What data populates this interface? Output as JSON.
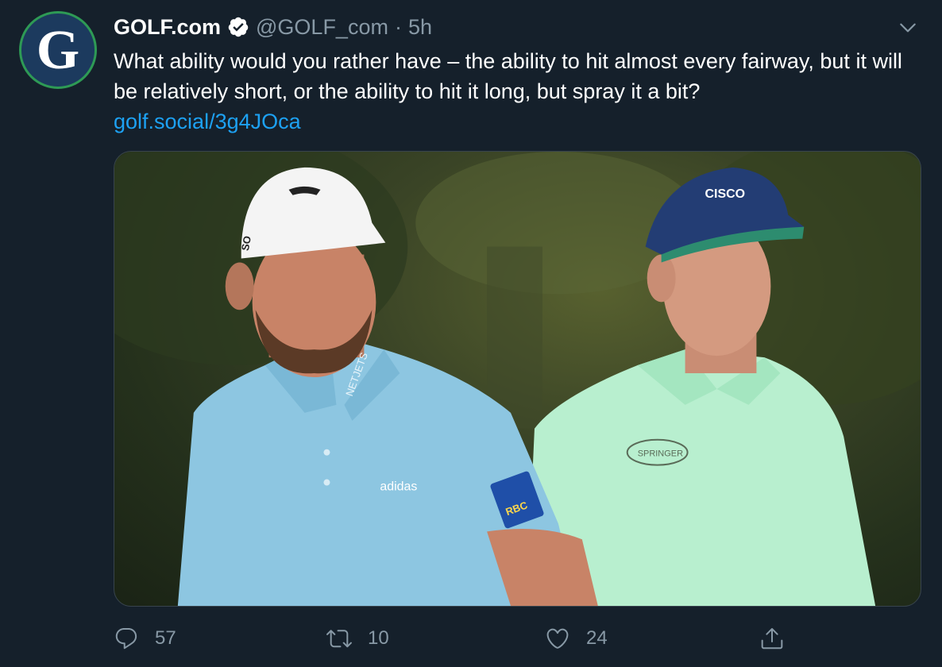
{
  "tweet": {
    "author": {
      "avatar_letter": "G",
      "display_name": "GOLF.com",
      "handle": "@GOLF_com",
      "separator": "·",
      "time": "5h",
      "verified": true
    },
    "text": "What ability would you rather have – the ability to hit almost every fairway, but it will be relatively short, or the ability to hit it long, but spray it a bit?",
    "link": "golf.social/3g4JOca",
    "media": {
      "cap_logo_left": "SO",
      "shirt_text_collar": "NETJETS",
      "shirt_logo": "adidas",
      "sleeve_badge": "RBC",
      "cap_logo_right": "CISCO",
      "chest_logo_right": "SPRINGER"
    },
    "actions": {
      "reply_count": "57",
      "retweet_count": "10",
      "like_count": "24"
    }
  },
  "colors": {
    "background": "#15202b",
    "text": "#ffffff",
    "secondary": "#8899a6",
    "link": "#1da1f2",
    "avatar_ring": "#2e9a55",
    "avatar_bg": "#1c3a5e"
  },
  "icons": [
    "verified-badge-icon",
    "chevron-down-icon",
    "reply-icon",
    "retweet-icon",
    "like-icon",
    "share-icon"
  ]
}
